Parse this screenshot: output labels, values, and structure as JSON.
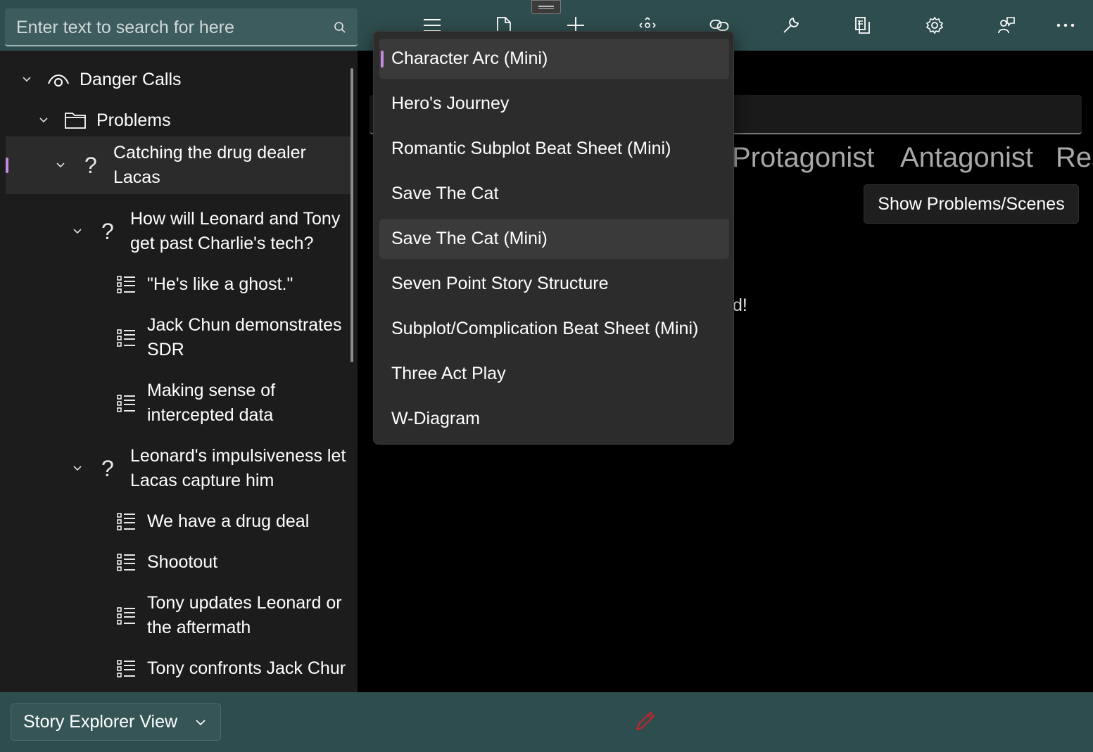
{
  "search": {
    "placeholder": "Enter text to search for here"
  },
  "toolbar": {
    "icons": [
      "menu-icon",
      "new-document-icon",
      "add-icon",
      "move-icon",
      "link-icon",
      "tools-icon",
      "copy-icon",
      "settings-icon",
      "feedback-icon",
      "more-icon"
    ]
  },
  "tree": {
    "items": [
      {
        "label": "Danger Calls",
        "icon": "eye-icon"
      },
      {
        "label": "Problems",
        "icon": "folder-icon"
      },
      {
        "label": "Catching the drug dealer\nLacas",
        "icon": "question-icon"
      },
      {
        "label": "How will Leonard and Tony\nget past Charlie's tech?",
        "icon": "question-icon"
      },
      {
        "label": "\"He's like a ghost.\"",
        "icon": "list-icon"
      },
      {
        "label": "Jack Chun demonstrates\nSDR",
        "icon": "list-icon"
      },
      {
        "label": "Making sense of\nintercepted data",
        "icon": "list-icon"
      },
      {
        "label": "Leonard's impulsiveness let\nLacas capture him",
        "icon": "question-icon"
      },
      {
        "label": "We have a drug deal",
        "icon": "list-icon"
      },
      {
        "label": "Shootout",
        "icon": "list-icon"
      },
      {
        "label": "Tony updates Leonard or\nthe aftermath",
        "icon": "list-icon"
      },
      {
        "label": "Tony confronts Jack Chur",
        "icon": "list-icon"
      }
    ]
  },
  "main": {
    "tabs": [
      "Protagonist",
      "Antagonist",
      "Res"
    ],
    "show_button": "Show Problems/Scenes",
    "fragment_text": "d!"
  },
  "dropdown": {
    "options": [
      "Character Arc (Mini)",
      "Hero's Journey",
      "Romantic Subplot Beat Sheet (Mini)",
      "Save The Cat",
      "Save The Cat (Mini)",
      "Seven Point Story Structure",
      "Subplot/Complication Beat Sheet (Mini)",
      "Three Act Play",
      "W-Diagram"
    ],
    "selected": "Character Arc (Mini)",
    "hovered": "Save The Cat (Mini)"
  },
  "bottom": {
    "view_label": "Story Explorer View",
    "icons": [
      "chevron-down-icon",
      "pencil-icon"
    ]
  },
  "colors": {
    "bar": "#2e4d4e",
    "accent": "#c58ae0",
    "pencil": "#c0262b"
  }
}
